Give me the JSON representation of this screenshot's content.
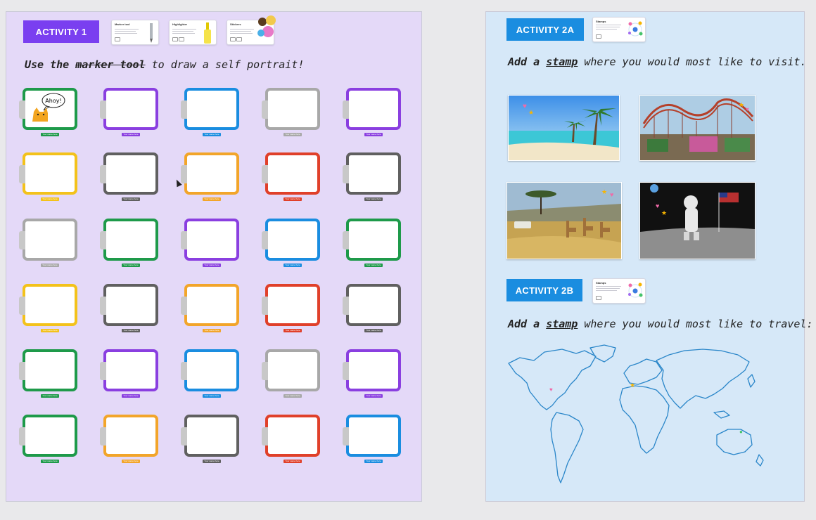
{
  "activity1": {
    "badge": "ACTIVITY 1",
    "instruction_pre": "Use the",
    "instruction_tool": "marker tool",
    "instruction_post": "to draw a self portrait!",
    "cards": [
      {
        "title": "Marker tool"
      },
      {
        "title": "Highlighter"
      },
      {
        "title": "Stickers"
      }
    ],
    "speech_bubble": "Ahoy!",
    "name_tag": "Your name here",
    "frame_colors": [
      "#1e9a4a",
      "#8a3fe0",
      "#1a8de0",
      "#a8a8a8",
      "#8a3fe0",
      "#f3c21b",
      "#606060",
      "#f2a52a",
      "#e0402a",
      "#606060",
      "#a8a8a8",
      "#1e9a4a",
      "#8a3fe0",
      "#1a8de0",
      "#1e9a4a",
      "#f3c21b",
      "#606060",
      "#f2a52a",
      "#e0402a",
      "#606060",
      "#1e9a4a",
      "#8a3fe0",
      "#1a8de0",
      "#a8a8a8",
      "#8a3fe0",
      "#1e9a4a",
      "#f2a52a",
      "#606060",
      "#e0402a",
      "#1a8de0"
    ]
  },
  "activity2a": {
    "badge": "ACTIVITY 2A",
    "card_title": "Stamps",
    "instruction_pre": "Add a",
    "instruction_bold": "stamp",
    "instruction_post": "where you would most like to visit.",
    "photos": [
      "beach-photo",
      "theme-park-photo",
      "safari-photo",
      "moon-photo"
    ]
  },
  "activity2b": {
    "badge": "ACTIVITY 2B",
    "card_title": "Stamps",
    "instruction_pre": "Add a",
    "instruction_bold": "stamp",
    "instruction_post": "where you would most like to travel:"
  },
  "colors": {
    "purple_badge": "#7a3ff0",
    "blue_badge": "#1a8de0",
    "activity1_bg": "#e4d9f8",
    "activity2_bg": "#d6e8f8",
    "map_outline": "#2a86c9"
  }
}
